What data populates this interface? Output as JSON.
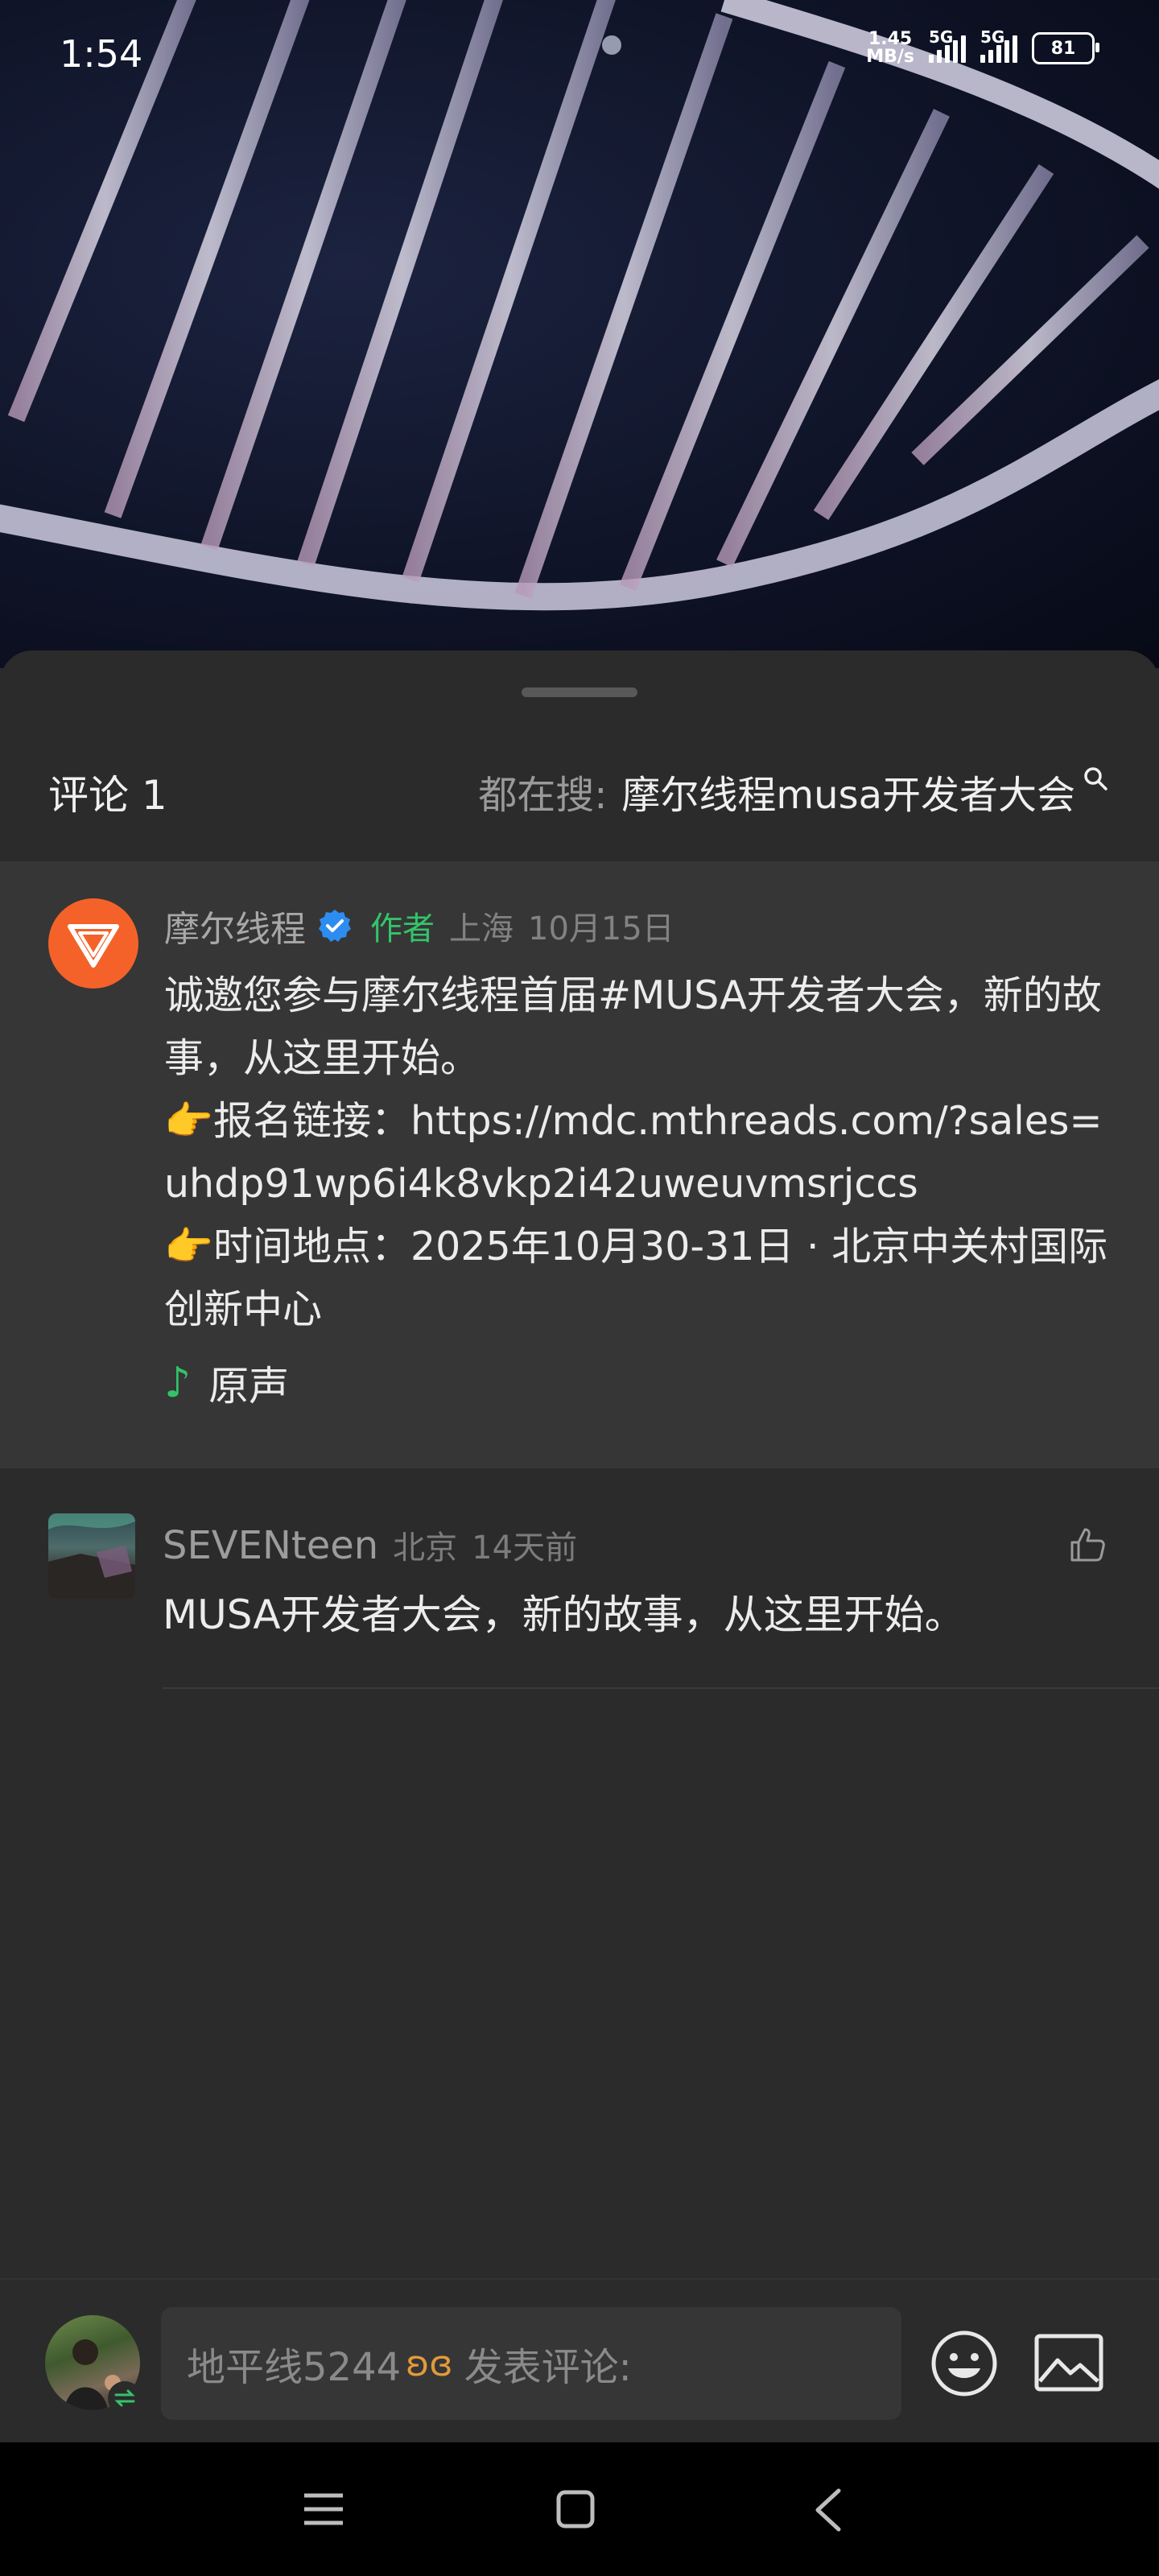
{
  "status_bar": {
    "time": "1:54",
    "speed_value": "1.45",
    "speed_unit": "MB/s",
    "signal1_label": "5G",
    "signal2_label": "5G",
    "battery": "81"
  },
  "comments_sheet": {
    "count_label": "评论 1",
    "search_prefix": "都在搜:",
    "search_term": "摩尔线程musa开发者大会"
  },
  "pinned_comment": {
    "author": "摩尔线程",
    "author_tag": "作者",
    "location": "上海",
    "date": "10月15日",
    "lines": [
      "诚邀您参与摩尔线程首届#MUSA开发者大会，新的故事，从这里开始。",
      "👉报名链接：https://mdc.mthreads.com/?sales=uhdp91wp6i4k8vkp2i42uweuvmsrjccs",
      "👉时间地点：2025年10月30-31日 · 北京中关村国际创新中心"
    ],
    "sound_label": "原声"
  },
  "comment2": {
    "author": "SEVENteen",
    "location": "北京",
    "time": "14天前",
    "text": "MUSA开发者大会，新的故事，从这里开始。"
  },
  "input_bar": {
    "user_handle": "地平线5244",
    "placeholder": "发表评论:"
  },
  "colors": {
    "accent_green": "#33c46a",
    "brand_orange": "#f4622a",
    "verified_blue": "#2d8cf0"
  }
}
